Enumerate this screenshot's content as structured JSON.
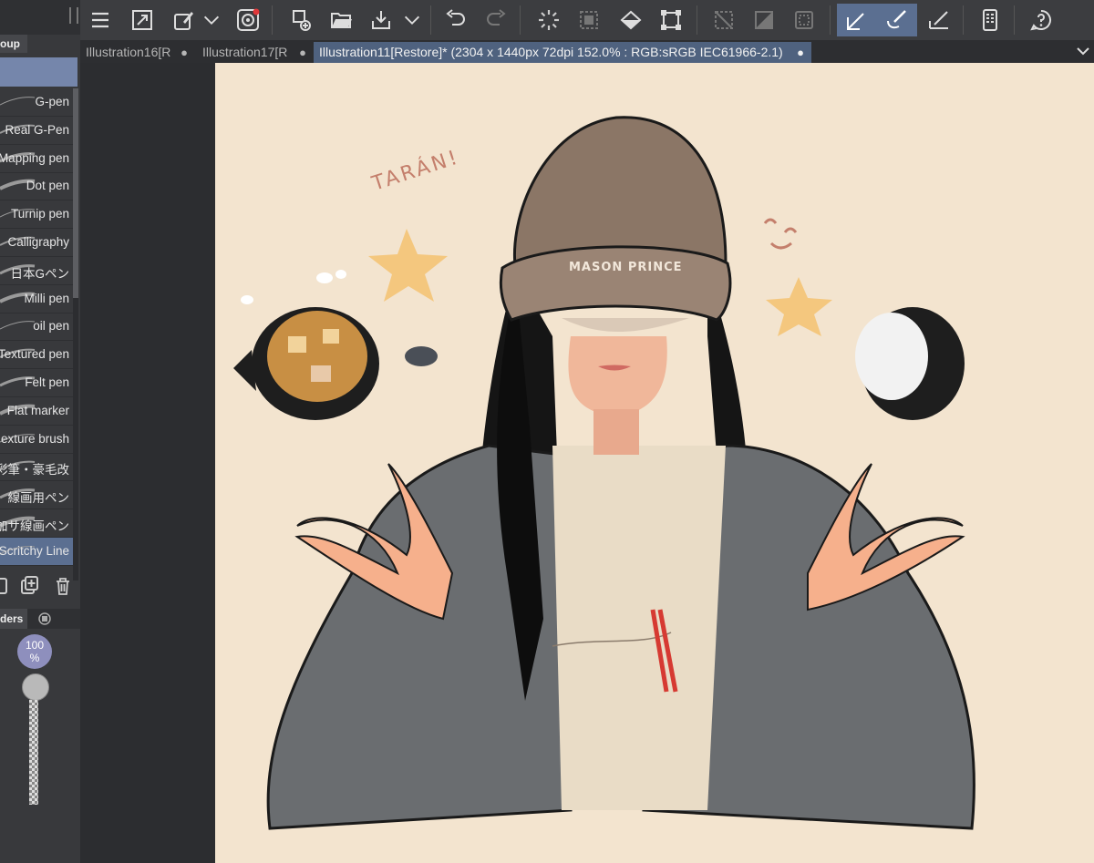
{
  "left_panel": {
    "group_tab_label": "oup",
    "brushes": [
      {
        "label": "G-pen"
      },
      {
        "label": "Real G-Pen"
      },
      {
        "label": "Mapping pen"
      },
      {
        "label": "Dot pen"
      },
      {
        "label": "Turnip pen"
      },
      {
        "label": "Calligraphy"
      },
      {
        "label": "日本Gペン"
      },
      {
        "label": "Milli pen"
      },
      {
        "label": "oil pen"
      },
      {
        "label": "Textured pen"
      },
      {
        "label": "Felt pen"
      },
      {
        "label": "Flat marker"
      },
      {
        "label": "exture brush"
      },
      {
        "label": "彩筆・豪毛改"
      },
      {
        "label": "線画用ペン"
      },
      {
        "label": "加サ線画ペン"
      },
      {
        "label": "Scritchy Line"
      }
    ],
    "selected_brush_index": 16,
    "sliders_tab_label": "ders",
    "opacity_value": "100",
    "opacity_unit": "%"
  },
  "toolbar": {
    "icons": [
      "menu-icon",
      "resize-canvas-icon",
      "layer-property-icon",
      "dropdown-icon",
      "app-logo-icon",
      "new-canvas-icon",
      "open-folder-icon",
      "save-icon",
      "dropdown-icon",
      "undo-icon",
      "redo-icon",
      "loading-icon",
      "select-all-icon",
      "fill-icon",
      "transform-icon",
      "deselect-icon",
      "invert-selection-icon",
      "selection-border-icon",
      "pen-stabilize-icon",
      "brush-stabilize-icon",
      "ruler-pen-icon",
      "device-icon",
      "help-icon"
    ]
  },
  "tabs": [
    {
      "label": "Illustration16[R",
      "dot": "●"
    },
    {
      "label": "Illustration17[R",
      "dot": "●"
    },
    {
      "label": "Illustration11[Restore]* (2304 x 1440px 72dpi 152.0% : RGB:sRGB IEC61966-2.1)",
      "dot": "●"
    }
  ],
  "canvas": {
    "background": "#f3e4cf",
    "artwork_text": {
      "cap_text": "MASON PRINCE",
      "exclamation": "TARÁN!"
    }
  },
  "colors": {
    "accent": "#5b6f91",
    "panel": "#38393c",
    "toolbar": "#3c3d40"
  }
}
